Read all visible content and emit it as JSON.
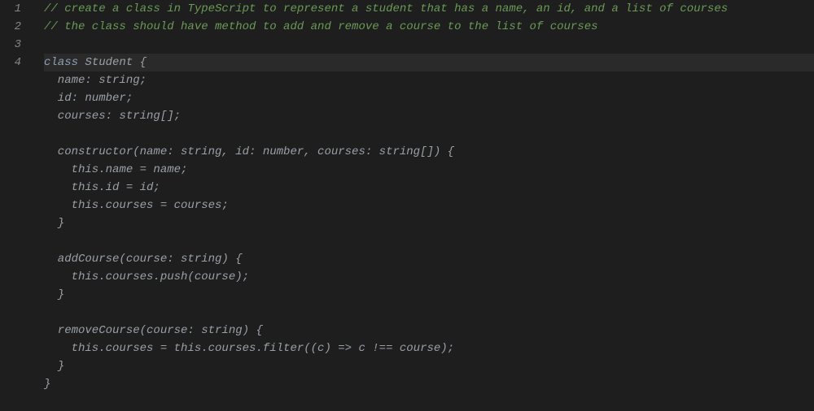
{
  "gutter": {
    "lines": [
      "1",
      "2",
      "3",
      "4"
    ]
  },
  "code": {
    "line1": "// create a class in TypeScript to represent a student that has a name, an id, and a list of courses",
    "line2": "// the class should have method to add and remove a course to the list of courses",
    "line3": "",
    "line4_class": "class",
    "line4_name": " Student ",
    "line4_brace": "{",
    "line5": "  name: string;",
    "line6": "  id: number;",
    "line7": "  courses: string[];",
    "line8": "",
    "line9": "  constructor(name: string, id: number, courses: string[]) {",
    "line10": "    this.name = name;",
    "line11": "    this.id = id;",
    "line12": "    this.courses = courses;",
    "line13": "  }",
    "line14": "",
    "line15": "  addCourse(course: string) {",
    "line16": "    this.courses.push(course);",
    "line17": "  }",
    "line18": "",
    "line19": "  removeCourse(course: string) {",
    "line20": "    this.courses = this.courses.filter((c) => c !== course);",
    "line21": "  }",
    "line22": "}"
  }
}
